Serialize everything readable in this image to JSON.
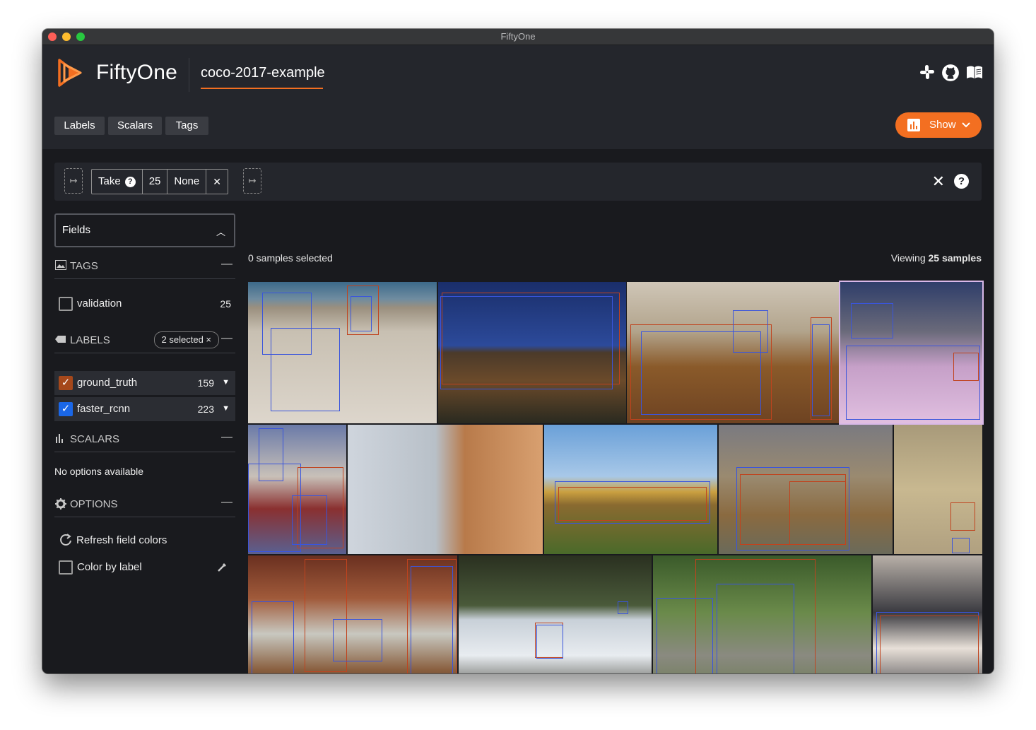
{
  "window": {
    "title": "FiftyOne"
  },
  "header": {
    "brand": "FiftyOne",
    "dataset": "coco-2017-example"
  },
  "toolbar": {
    "tabs": [
      "Labels",
      "Scalars",
      "Tags"
    ],
    "show_label": "Show"
  },
  "view_bar": {
    "stage_name": "Take",
    "stage_value": "25",
    "stage_seed": "None"
  },
  "sidebar": {
    "fields_label": "Fields",
    "tags": {
      "title": "TAGS",
      "items": [
        {
          "label": "validation",
          "count": "25"
        }
      ]
    },
    "labels": {
      "title": "LABELS",
      "badge": "2 selected ×",
      "items": [
        {
          "label": "ground_truth",
          "count": "159",
          "color": "#a5481b"
        },
        {
          "label": "faster_rcnn",
          "count": "223",
          "color": "#1a67e8"
        }
      ]
    },
    "scalars": {
      "title": "SCALARS",
      "empty": "No options available"
    },
    "options": {
      "title": "OPTIONS",
      "refresh": "Refresh field colors",
      "color_by_label": "Color by label"
    }
  },
  "grid": {
    "selected_text": "0 samples selected",
    "viewing_prefix": "Viewing",
    "viewing_count": "25 samples"
  },
  "colors": {
    "accent": "#f36f21",
    "ground_truth": "#c0431e",
    "faster_rcnn": "#3a55dc"
  }
}
